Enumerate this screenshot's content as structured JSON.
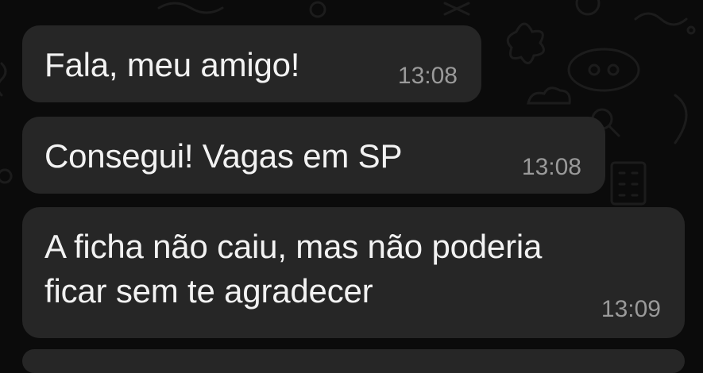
{
  "chat": {
    "messages": [
      {
        "text": "Fala, meu amigo!",
        "time": "13:08"
      },
      {
        "text": "Consegui! Vagas em SP",
        "time": "13:08"
      },
      {
        "text": "A ficha não caiu, mas não poderia\nficar sem te agradecer",
        "time": "13:09"
      }
    ]
  },
  "colors": {
    "background": "#0b0b0b",
    "bubble": "#262626",
    "text": "#f2f2f2",
    "timestamp": "#9a9a9a",
    "doodle": "#1c1c1c"
  },
  "wallpaper": {
    "icons": [
      "chat-doodle-wallpaper",
      "alien-face-icon",
      "cloud-icon",
      "magnifier-icon",
      "building-icon",
      "flower-icon"
    ]
  }
}
